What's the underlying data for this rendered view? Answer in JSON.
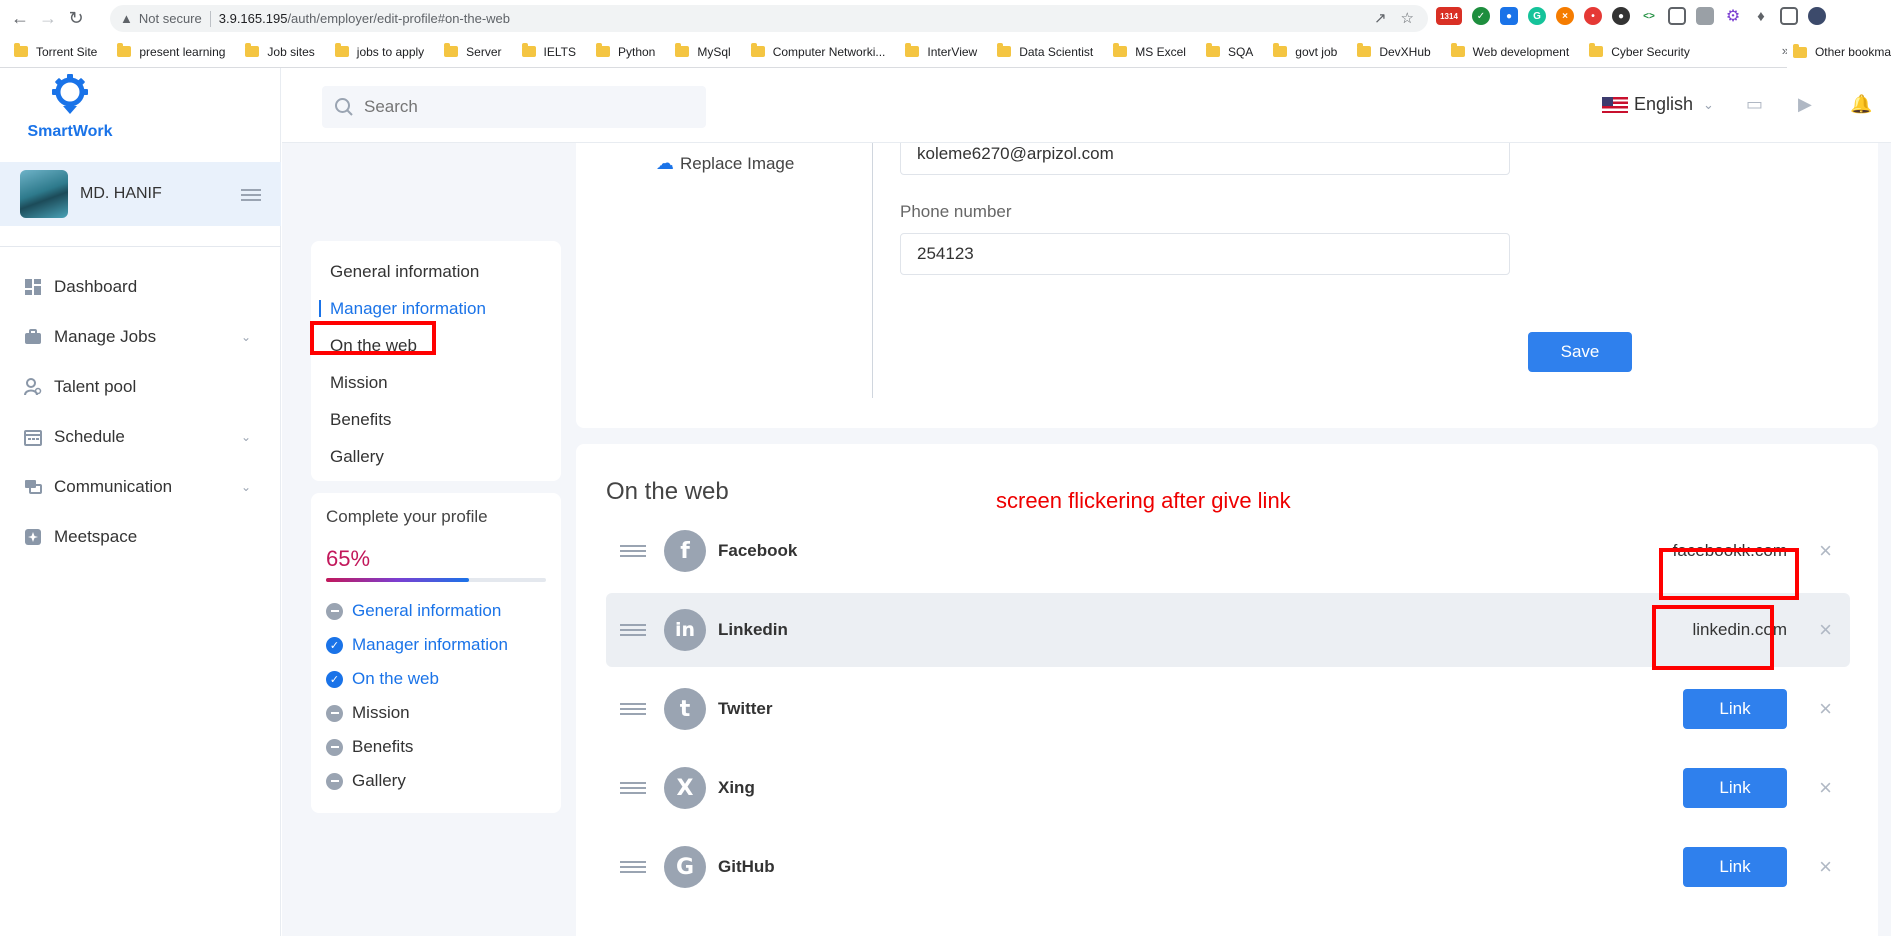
{
  "browser": {
    "url_security": "Not secure",
    "url_host": "3.9.165.195",
    "url_path": "/auth/employer/edit-profile#on-the-web",
    "gmail_badge": "1314"
  },
  "bookmarks": {
    "items": [
      "Torrent Site",
      "present learning",
      "Job sites",
      "jobs to apply",
      "Server",
      "IELTS",
      "Python",
      "MySql",
      "Computer Networki...",
      "InterView",
      "Data Scientist",
      "MS Excel",
      "SQA",
      "govt job",
      "DevXHub",
      "Web development",
      "Cyber Security"
    ],
    "more": "»",
    "other": "Other bookma"
  },
  "sidebar": {
    "brand": "SmartWork",
    "username": "MD. HANIF",
    "items": [
      {
        "label": "Dashboard",
        "icon": "dashboard-icon",
        "chevron": false
      },
      {
        "label": "Manage Jobs",
        "icon": "briefcase-icon",
        "chevron": true
      },
      {
        "label": "Talent pool",
        "icon": "user-search-icon",
        "chevron": false
      },
      {
        "label": "Schedule",
        "icon": "calendar-icon",
        "chevron": true
      },
      {
        "label": "Communication",
        "icon": "chat-icon",
        "chevron": true
      },
      {
        "label": "Meetspace",
        "icon": "meetspace-icon",
        "chevron": false
      }
    ]
  },
  "header": {
    "search_placeholder": "Search",
    "language": "English"
  },
  "profile_nav": {
    "items": [
      "General information",
      "Manager information",
      "On the web",
      "Mission",
      "Benefits",
      "Gallery"
    ],
    "active_index": 1
  },
  "progress": {
    "title": "Complete your profile",
    "value_text": "65%",
    "value": 0.65,
    "items": [
      {
        "label": "General information",
        "done": false,
        "color": "blue"
      },
      {
        "label": "Manager information",
        "done": true,
        "color": "blue"
      },
      {
        "label": "On the web",
        "done": true,
        "color": "blue"
      },
      {
        "label": "Mission",
        "done": false,
        "color": "gray"
      },
      {
        "label": "Benefits",
        "done": false,
        "color": "gray"
      },
      {
        "label": "Gallery",
        "done": false,
        "color": "gray"
      }
    ]
  },
  "form": {
    "replace_image": "Replace Image",
    "email_value": "koleme6270@arpizol.com",
    "phone_label": "Phone number",
    "phone_value": "254123",
    "save_label": "Save"
  },
  "web": {
    "title": "On the web",
    "annotation": "screen flickering after give link",
    "rows": [
      {
        "name": "Facebook",
        "icon_glyph": "f",
        "value": "facebookk.com",
        "button": null
      },
      {
        "name": "Linkedin",
        "icon_glyph": "in",
        "value": "linkedin.com",
        "button": null
      },
      {
        "name": "Twitter",
        "icon_glyph": "t",
        "value": null,
        "button": "Link"
      },
      {
        "name": "Xing",
        "icon_glyph": "X",
        "value": null,
        "button": "Link"
      },
      {
        "name": "GitHub",
        "icon_glyph": "G",
        "value": null,
        "button": "Link"
      }
    ]
  },
  "colors": {
    "accent": "#2f80ed",
    "annotation": "#ff0000",
    "progress": "#c2185b"
  }
}
